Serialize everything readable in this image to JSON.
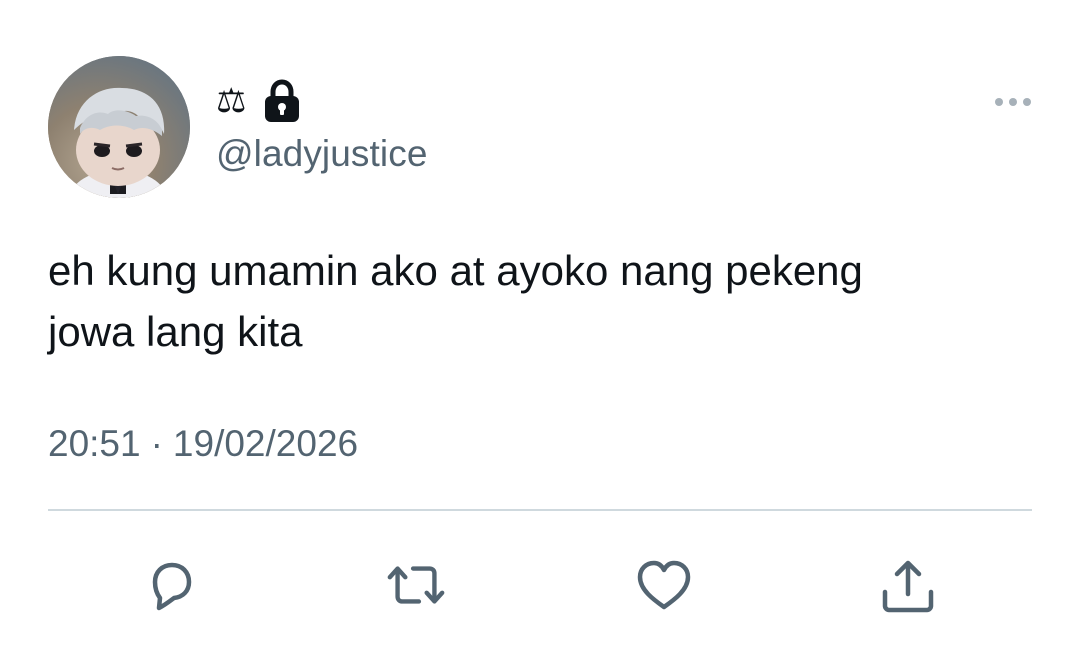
{
  "tweet": {
    "display_name": "⚖",
    "handle": "@ladyjustice",
    "text": "eh kung umamin ako at ayoko nang pekeng\njowa lang kita",
    "time": "20:51",
    "separator": "·",
    "date": "19/02/2026"
  },
  "icons": {
    "avatar": "cartoon-boy-avatar",
    "lock": "lock-icon",
    "more": "more-dots-icon",
    "reply": "reply-icon",
    "retweet": "retweet-icon",
    "like": "heart-icon",
    "share": "share-icon"
  },
  "colors": {
    "text": "#0f1419",
    "secondary": "#536471",
    "divider": "#cfd9de",
    "icon": "#536471"
  }
}
